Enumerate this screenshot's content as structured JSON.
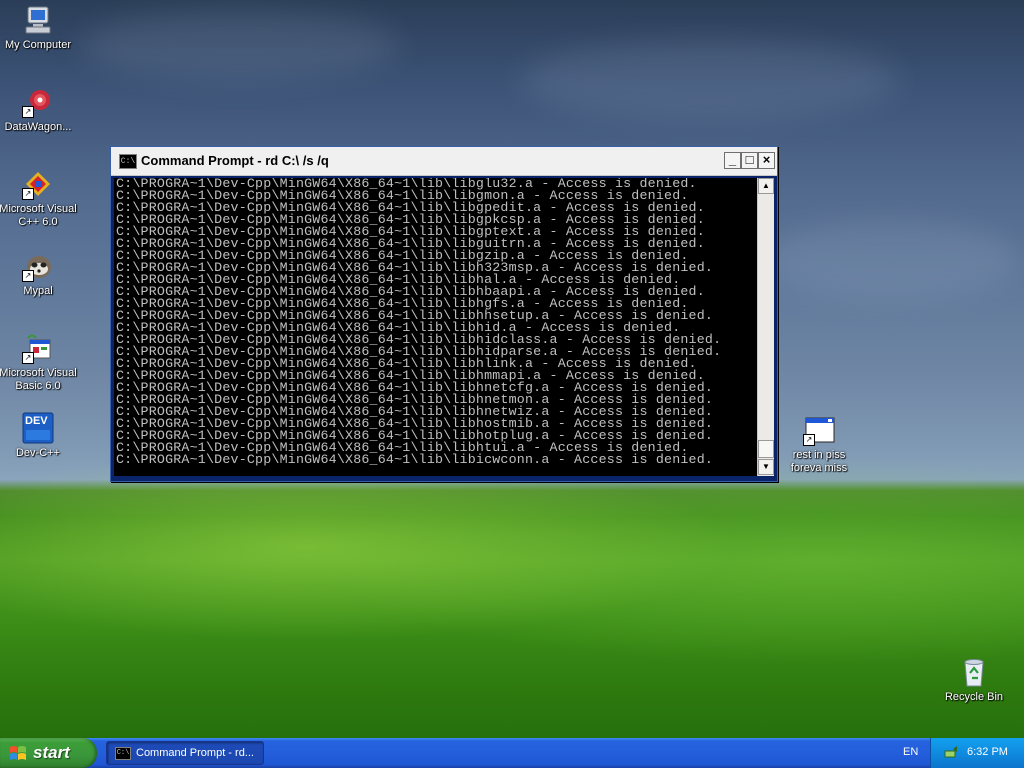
{
  "desktop": {
    "icons": [
      {
        "label": "My Computer",
        "icon": "my-computer-icon"
      },
      {
        "label": "DataWagon...",
        "icon": "datawagon-icon"
      },
      {
        "label": "Microsoft Visual C++ 6.0",
        "icon": "visual-cpp-icon"
      },
      {
        "label": "Mypal",
        "icon": "mypal-icon"
      },
      {
        "label": "Microsoft Visual Basic 6.0",
        "icon": "visual-basic-icon"
      },
      {
        "label": "Dev-C++",
        "icon": "dev-cpp-icon"
      },
      {
        "label": "rest in piss foreva miss",
        "icon": "program-window-icon"
      },
      {
        "label": "Recycle Bin",
        "icon": "recycle-bin-icon"
      }
    ],
    "dev_badge_text": "DEV"
  },
  "window": {
    "title": "Command Prompt - rd C:\\ /s /q",
    "icon_text": "C:\\",
    "controls": {
      "minimize": "_",
      "maximize": "□",
      "close": "×"
    },
    "console_lines": [
      "C:\\PROGRA~1\\Dev-Cpp\\MinGW64\\X86_64~1\\lib\\libglu32.a - Access is denied.",
      "C:\\PROGRA~1\\Dev-Cpp\\MinGW64\\X86_64~1\\lib\\libgmon.a - Access is denied.",
      "C:\\PROGRA~1\\Dev-Cpp\\MinGW64\\X86_64~1\\lib\\libgpedit.a - Access is denied.",
      "C:\\PROGRA~1\\Dev-Cpp\\MinGW64\\X86_64~1\\lib\\libgpkcsp.a - Access is denied.",
      "C:\\PROGRA~1\\Dev-Cpp\\MinGW64\\X86_64~1\\lib\\libgptext.a - Access is denied.",
      "C:\\PROGRA~1\\Dev-Cpp\\MinGW64\\X86_64~1\\lib\\libguitrn.a - Access is denied.",
      "C:\\PROGRA~1\\Dev-Cpp\\MinGW64\\X86_64~1\\lib\\libgzip.a - Access is denied.",
      "C:\\PROGRA~1\\Dev-Cpp\\MinGW64\\X86_64~1\\lib\\libh323msp.a - Access is denied.",
      "C:\\PROGRA~1\\Dev-Cpp\\MinGW64\\X86_64~1\\lib\\libhal.a - Access is denied.",
      "C:\\PROGRA~1\\Dev-Cpp\\MinGW64\\X86_64~1\\lib\\libhbaapi.a - Access is denied.",
      "C:\\PROGRA~1\\Dev-Cpp\\MinGW64\\X86_64~1\\lib\\libhgfs.a - Access is denied.",
      "C:\\PROGRA~1\\Dev-Cpp\\MinGW64\\X86_64~1\\lib\\libhhsetup.a - Access is denied.",
      "C:\\PROGRA~1\\Dev-Cpp\\MinGW64\\X86_64~1\\lib\\libhid.a - Access is denied.",
      "C:\\PROGRA~1\\Dev-Cpp\\MinGW64\\X86_64~1\\lib\\libhidclass.a - Access is denied.",
      "C:\\PROGRA~1\\Dev-Cpp\\MinGW64\\X86_64~1\\lib\\libhidparse.a - Access is denied.",
      "C:\\PROGRA~1\\Dev-Cpp\\MinGW64\\X86_64~1\\lib\\libhlink.a - Access is denied.",
      "C:\\PROGRA~1\\Dev-Cpp\\MinGW64\\X86_64~1\\lib\\libhmmapi.a - Access is denied.",
      "C:\\PROGRA~1\\Dev-Cpp\\MinGW64\\X86_64~1\\lib\\libhnetcfg.a - Access is denied.",
      "C:\\PROGRA~1\\Dev-Cpp\\MinGW64\\X86_64~1\\lib\\libhnetmon.a - Access is denied.",
      "C:\\PROGRA~1\\Dev-Cpp\\MinGW64\\X86_64~1\\lib\\libhnetwiz.a - Access is denied.",
      "C:\\PROGRA~1\\Dev-Cpp\\MinGW64\\X86_64~1\\lib\\libhostmib.a - Access is denied.",
      "C:\\PROGRA~1\\Dev-Cpp\\MinGW64\\X86_64~1\\lib\\libhotplug.a - Access is denied.",
      "C:\\PROGRA~1\\Dev-Cpp\\MinGW64\\X86_64~1\\lib\\libhtui.a - Access is denied.",
      "C:\\PROGRA~1\\Dev-Cpp\\MinGW64\\X86_64~1\\lib\\libicwconn.a - Access is denied."
    ],
    "scrollbar": {
      "up_arrow": "▲",
      "down_arrow": "▼"
    }
  },
  "taskbar": {
    "start_label": "start",
    "task_item_label": "Command Prompt - rd...",
    "task_item_icon_text": "C:\\",
    "language": "EN",
    "clock": "6:32 PM"
  },
  "colors": {
    "console_text": "#c0c0c0",
    "console_bg": "#000000",
    "taskbar_blue": "#245edb",
    "start_green": "#3a963a"
  }
}
